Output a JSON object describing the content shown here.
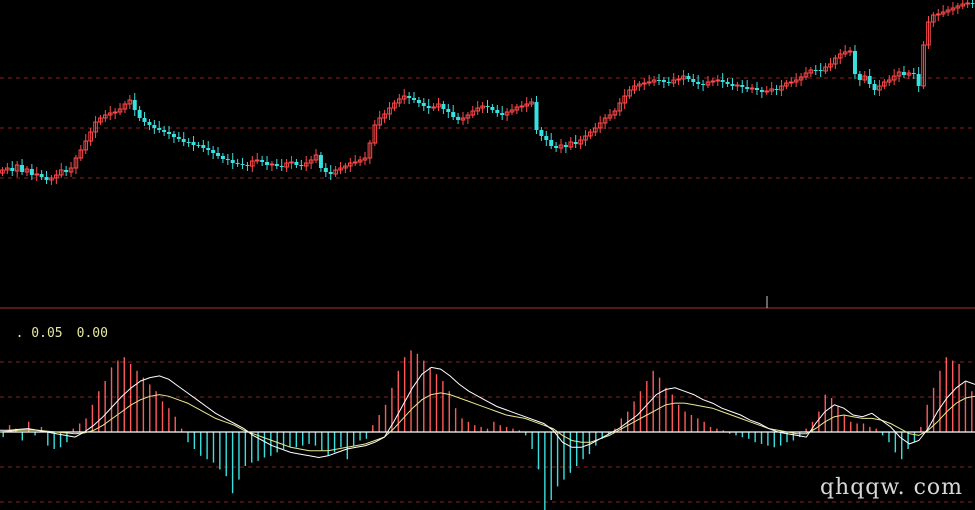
{
  "indicator": {
    "readout_1": ". 0.05",
    "readout_2": "0.00"
  },
  "watermark": "qhqqw. com",
  "colors": {
    "background": "#000000",
    "up_candle": "#ff4a4a",
    "down_candle": "#39e0e0",
    "grid_dash": "#8a2020",
    "separator": "#b03030",
    "zero_line": "#ffffff",
    "dif_line": "#ffffff",
    "dea_line": "#e8e890",
    "hist_pos": "#ff5a5a",
    "hist_neg": "#39e0e0"
  },
  "chart_data": [
    {
      "type": "candlestick",
      "description_free": true,
      "grid": true,
      "close": [
        170,
        168,
        171,
        165,
        172,
        169,
        175,
        174,
        177,
        180,
        178,
        175,
        170,
        172,
        168,
        158,
        150,
        141,
        132,
        122,
        118,
        115,
        113,
        112,
        109,
        104,
        100,
        110,
        118,
        122,
        125,
        128,
        130,
        132,
        134,
        137,
        139,
        142,
        142,
        145,
        145,
        148,
        150,
        153,
        156,
        159,
        160,
        163,
        164,
        165,
        166,
        161,
        160,
        162,
        165,
        164,
        166,
        167,
        163,
        162,
        165,
        166,
        163,
        160,
        155,
        168,
        172,
        174,
        170,
        168,
        166,
        163,
        162,
        160,
        158,
        143,
        125,
        118,
        114,
        108,
        103,
        99,
        96,
        98,
        100,
        103,
        106,
        108,
        107,
        104,
        109,
        112,
        117,
        120,
        118,
        115,
        111,
        108,
        106,
        107,
        110,
        113,
        115,
        112,
        110,
        107,
        106,
        104,
        102,
        130,
        136,
        140,
        146,
        148,
        145,
        147,
        142,
        144,
        140,
        136,
        132,
        128,
        123,
        118,
        115,
        111,
        103,
        96,
        90,
        86,
        84,
        83,
        82,
        80,
        80,
        82,
        83,
        80,
        79,
        76,
        79,
        82,
        84,
        85,
        82,
        81,
        80,
        82,
        84,
        86,
        85,
        87,
        89,
        88,
        90,
        92,
        91,
        89,
        90,
        86,
        83,
        82,
        80,
        77,
        73,
        70,
        70,
        71,
        67,
        64,
        58,
        54,
        52,
        51,
        74,
        80,
        76,
        84,
        90,
        86,
        82,
        80,
        76,
        72,
        75,
        73,
        74,
        86,
        45,
        22,
        15,
        14,
        12,
        10,
        8,
        6,
        4,
        3,
        3
      ],
      "price_range": [
        0,
        300
      ]
    },
    {
      "type": "macd",
      "zero_at": 0,
      "hist": [
        -0.3,
        0.4,
        0.2,
        -0.5,
        0.6,
        -0.2,
        0.3,
        -0.8,
        -1.0,
        -0.9,
        -0.6,
        0.2,
        0.5,
        0.8,
        1.6,
        2.4,
        3.0,
        3.8,
        4.2,
        4.4,
        4.0,
        3.6,
        3.2,
        2.8,
        2.4,
        1.8,
        1.4,
        0.9,
        0.2,
        -0.6,
        -1.0,
        -1.4,
        -1.6,
        -1.8,
        -2.2,
        -2.6,
        -3.6,
        -2.8,
        -2.0,
        -1.8,
        -1.7,
        -1.5,
        -1.4,
        -1.2,
        -1.0,
        -0.9,
        -0.9,
        -0.8,
        -0.7,
        -0.8,
        -1.1,
        -1.4,
        -1.2,
        -0.9,
        -1.6,
        -0.8,
        -0.5,
        -0.4,
        0.4,
        1.0,
        1.6,
        2.6,
        3.6,
        4.4,
        4.8,
        4.6,
        4.2,
        3.8,
        3.4,
        3.0,
        2.4,
        1.4,
        0.8,
        0.6,
        0.4,
        0.3,
        0.2,
        0.6,
        0.4,
        0.3,
        0.2,
        0.1,
        -0.2,
        -1.0,
        -2.2,
        -4.8,
        -4.0,
        -3.2,
        -2.8,
        -2.4,
        -2.0,
        -1.6,
        -1.3,
        -0.8,
        -0.4,
        -0.1,
        0.2,
        0.8,
        1.2,
        1.8,
        2.4,
        3.0,
        3.6,
        3.2,
        2.6,
        2.2,
        1.6,
        1.2,
        1.0,
        0.8,
        0.6,
        0.3,
        0.2,
        0.1,
        -0.1,
        -0.2,
        -0.3,
        -0.4,
        -0.6,
        -0.7,
        -0.8,
        -0.9,
        -0.8,
        -0.6,
        -0.5,
        -0.3,
        0.2,
        0.6,
        1.2,
        2.2,
        2.0,
        1.5,
        1.0,
        0.6,
        0.5,
        0.5,
        0.3,
        0.2,
        -0.2,
        -0.6,
        -1.2,
        -1.6,
        -1.0,
        -0.6,
        0.3,
        1.6,
        2.6,
        3.6,
        4.4,
        4.2,
        4.0,
        3.0,
        2.4
      ],
      "dif": [
        0.1,
        0.1,
        0.15,
        0.2,
        0.1,
        0.0,
        -0.1,
        -0.2,
        -0.3,
        0.0,
        0.4,
        0.9,
        1.5,
        2.1,
        2.6,
        3.0,
        3.2,
        3.3,
        3.1,
        2.7,
        2.3,
        1.9,
        1.5,
        1.1,
        0.8,
        0.5,
        0.2,
        -0.2,
        -0.5,
        -0.8,
        -1.0,
        -1.2,
        -1.3,
        -1.4,
        -1.5,
        -1.4,
        -1.2,
        -1.0,
        -0.9,
        -0.8,
        -0.6,
        -0.3,
        0.6,
        1.6,
        2.6,
        3.4,
        3.8,
        3.7,
        3.3,
        2.8,
        2.4,
        2.1,
        1.8,
        1.5,
        1.3,
        1.1,
        0.9,
        0.7,
        0.5,
        0.1,
        -0.6,
        -0.9,
        -0.9,
        -0.7,
        -0.4,
        -0.1,
        0.2,
        0.6,
        1.0,
        1.6,
        2.2,
        2.5,
        2.6,
        2.4,
        2.2,
        1.9,
        1.7,
        1.4,
        1.2,
        1.0,
        0.7,
        0.5,
        0.2,
        0.0,
        -0.1,
        -0.2,
        -0.3,
        0.5,
        1.2,
        1.6,
        1.4,
        1.0,
        0.9,
        1.1,
        0.7,
        0.3,
        -0.3,
        -0.7,
        -0.5,
        0.2,
        1.2,
        2.0,
        2.6,
        3.0,
        2.8
      ],
      "dea": [
        0.0,
        0.05,
        0.1,
        0.12,
        0.1,
        0.05,
        0.0,
        -0.05,
        -0.1,
        -0.05,
        0.1,
        0.4,
        0.8,
        1.2,
        1.6,
        1.9,
        2.1,
        2.2,
        2.1,
        1.9,
        1.7,
        1.4,
        1.1,
        0.8,
        0.6,
        0.4,
        0.1,
        -0.1,
        -0.3,
        -0.5,
        -0.7,
        -0.9,
        -1.0,
        -1.1,
        -1.1,
        -1.1,
        -1.0,
        -0.9,
        -0.8,
        -0.7,
        -0.5,
        -0.3,
        0.2,
        0.8,
        1.4,
        1.9,
        2.2,
        2.3,
        2.2,
        2.0,
        1.8,
        1.6,
        1.4,
        1.2,
        1.0,
        0.9,
        0.8,
        0.6,
        0.4,
        0.2,
        -0.2,
        -0.5,
        -0.6,
        -0.6,
        -0.4,
        -0.2,
        0.1,
        0.4,
        0.7,
        1.0,
        1.3,
        1.6,
        1.7,
        1.7,
        1.6,
        1.5,
        1.4,
        1.2,
        1.0,
        0.8,
        0.6,
        0.4,
        0.2,
        0.1,
        0.0,
        -0.1,
        -0.1,
        0.2,
        0.6,
        0.9,
        1.0,
        0.9,
        0.8,
        0.8,
        0.7,
        0.5,
        0.2,
        -0.1,
        -0.2,
        0.1,
        0.6,
        1.2,
        1.7,
        2.0,
        2.1
      ],
      "hist_range": [
        -5.2,
        6.0
      ]
    }
  ]
}
